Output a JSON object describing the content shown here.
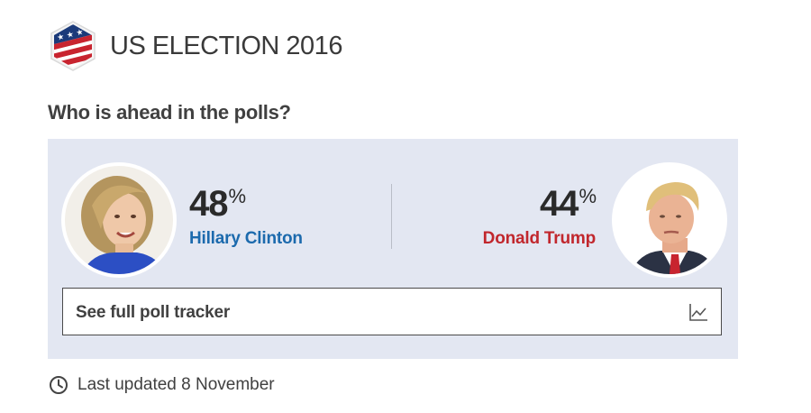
{
  "header": {
    "title": "US ELECTION 2016",
    "logo_icon": "us-flag-shield-icon"
  },
  "subtitle": "Who is ahead in the polls?",
  "candidates": [
    {
      "name": "Hillary Clinton",
      "percent": "48",
      "percent_sign": "%",
      "color": "#1c6aad",
      "photo": "hillary-clinton-portrait"
    },
    {
      "name": "Donald Trump",
      "percent": "44",
      "percent_sign": "%",
      "color": "#c1272d",
      "photo": "donald-trump-portrait"
    }
  ],
  "tracker_button": {
    "label": "See full poll tracker",
    "icon": "line-chart-icon"
  },
  "footer": {
    "updated": "Last updated 8 November",
    "icon": "clock-icon"
  },
  "colors": {
    "panel_bg": "#e3e7f2",
    "democrat": "#1c6aad",
    "republican": "#c1272d",
    "text": "#404040"
  }
}
